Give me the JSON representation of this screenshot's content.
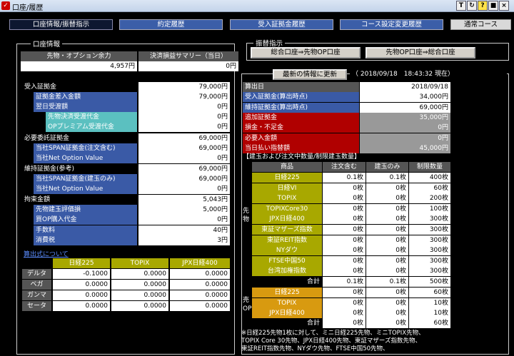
{
  "window": {
    "title": "口座/履歴",
    "btn_t": "T",
    "btn_refresh": "↻",
    "btn_help": "?",
    "btn_min": "■",
    "btn_close": "×"
  },
  "tabs": [
    "口座情報/振替指示",
    "約定履歴",
    "受入証拠金履歴",
    "コース設定変更履歴"
  ],
  "course": "通常コース",
  "account": {
    "frame_label": "口座情報",
    "h1": "先物・オプション余力",
    "h2": "決済損益サマリー（当日）",
    "v1": "4,957円",
    "v2": "0円",
    "rows": [
      {
        "label": "受入証拠金",
        "value": "79,000円"
      },
      {
        "label": "証拠金差入金額",
        "value": "79,000円"
      },
      {
        "label": "翌日受渡額",
        "value": "0円"
      },
      {
        "label": "先物決済受渡代金",
        "value": "0円"
      },
      {
        "label": "OPプレミアム受渡代金",
        "value": "0円"
      },
      {
        "label": "必要委託証拠金",
        "value": "69,000円"
      },
      {
        "label": "当社SPAN証拠金(注文含む)",
        "value": "69,000円"
      },
      {
        "label": "当社Net Option Value",
        "value": "0円"
      },
      {
        "label": "維持証拠金(参考)",
        "value": "69,000円"
      },
      {
        "label": "当社SPAN証拠金(建玉のみ)",
        "value": "69,000円"
      },
      {
        "label": "当社Net Option Value",
        "value": "0円"
      },
      {
        "label": "拘束金額",
        "value": "5,043円"
      },
      {
        "label": "先物建玉評価損",
        "value": "5,000円"
      },
      {
        "label": "買OP購入代金",
        "value": "0円"
      },
      {
        "label": "手数料",
        "value": "40円"
      },
      {
        "label": "消費税",
        "value": "3円"
      }
    ],
    "formula_link": "算出式について",
    "greeks": {
      "cols": [
        "日経225",
        "TOPIX",
        "JPX日経400"
      ],
      "rows": [
        {
          "name": "デルタ",
          "v": [
            "-0.1000",
            "0.0000",
            "0.0000"
          ]
        },
        {
          "name": "ベガ",
          "v": [
            "0.0000",
            "0.0000",
            "0.0000"
          ]
        },
        {
          "name": "ガンマ",
          "v": [
            "0.0000",
            "0.0000",
            "0.0000"
          ]
        },
        {
          "name": "セータ",
          "v": [
            "0.0000",
            "0.0000",
            "0.0000"
          ]
        }
      ]
    }
  },
  "transfer": {
    "frame_label": "振替指示",
    "b1": "総合口座⇒先物OP口座",
    "b2": "先物OP口座⇒総合口座"
  },
  "latest": {
    "button": "最新の情報に更新",
    "timestamp": "（ 2018/09/18　18:43:32 現在）"
  },
  "summary": [
    {
      "label": "算出日",
      "value": "2018/09/18",
      "style": "gray"
    },
    {
      "label": "受入証拠金(算出時点)",
      "value": "34,000円",
      "style": "blue"
    },
    {
      "label": "維持証拠金(算出時点)",
      "value": "69,000円",
      "style": "blue"
    },
    {
      "label": "追加証拠金",
      "value": "35,000円",
      "style": "red"
    },
    {
      "label": "損金・不足金",
      "value": "0円",
      "style": "red"
    },
    {
      "label": "必要入金額",
      "value": "0円",
      "style": "red"
    },
    {
      "label": "当日払い指替額",
      "value": "45,000円",
      "style": "red"
    }
  ],
  "positions": {
    "title": "【建玉および注文中数量/制限建玉数量】",
    "headers": [
      "商品",
      "注文含む",
      "建玉のみ",
      "制限数量"
    ],
    "futures_label": "先\n物",
    "futures": [
      {
        "name": "日経225",
        "a": "0.1枚",
        "b": "0.1枚",
        "c": "400枚"
      },
      {
        "name": "日経VI",
        "a": "0枚",
        "b": "0枚",
        "c": "60枚"
      },
      {
        "name": "TOPIX",
        "a": "0枚",
        "b": "0枚",
        "c": "200枚"
      },
      {
        "name": "TOPIXCore30",
        "a": "0枚",
        "b": "0枚",
        "c": "100枚"
      },
      {
        "name": "JPX日経400",
        "a": "0枚",
        "b": "0枚",
        "c": "300枚"
      },
      {
        "name": "東証マザーズ指数",
        "a": "0枚",
        "b": "0枚",
        "c": "300枚"
      },
      {
        "name": "東証REIT指数",
        "a": "0枚",
        "b": "0枚",
        "c": "300枚"
      },
      {
        "name": "NYダウ",
        "a": "0枚",
        "b": "0枚",
        "c": "300枚"
      },
      {
        "name": "FTSE中国50",
        "a": "0枚",
        "b": "0枚",
        "c": "300枚"
      },
      {
        "name": "台湾加権指数",
        "a": "0枚",
        "b": "0枚",
        "c": "300枚"
      }
    ],
    "futures_total": {
      "name": "合計",
      "a": "0.1枚",
      "b": "0.1枚",
      "c": "500枚"
    },
    "options_label": "売\nOP",
    "options": [
      {
        "name": "日経225",
        "a": "0枚",
        "b": "0枚",
        "c": "60枚"
      },
      {
        "name": "TOPIX",
        "a": "0枚",
        "b": "0枚",
        "c": "10枚"
      },
      {
        "name": "JPX日経400",
        "a": "0枚",
        "b": "0枚",
        "c": "10枚"
      }
    ],
    "options_total": {
      "name": "合計",
      "a": "0枚",
      "b": "0枚",
      "c": "60枚"
    }
  },
  "notes": [
    "※日経225先物1枚に対して、ミニ日経225先物、ミニTOPIX先物、",
    "TOPIX Core 30先物、JPX日経400先物、東証マザーズ指数先物、",
    "東証REIT指数先物、NYダウ先物、FTSE中国50先物、"
  ]
}
